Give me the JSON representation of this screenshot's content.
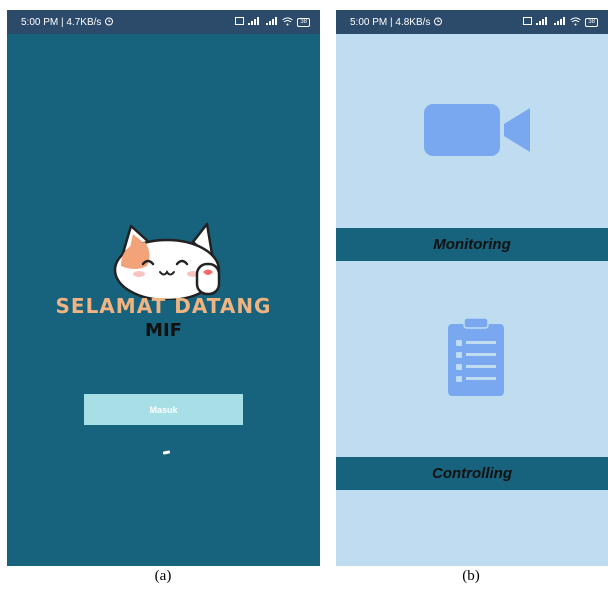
{
  "screen_a": {
    "status": {
      "time_speed": "5:00 PM | 4.7KB/s",
      "battery": "38"
    },
    "welcome_title": "SELAMAT DATANG",
    "welcome_subtitle": "MIF",
    "enter_button_label": "Masuk",
    "caption": "(a)"
  },
  "screen_b": {
    "status": {
      "time_speed": "5:00 PM | 4.8KB/s",
      "battery": "38"
    },
    "menu": [
      {
        "label": "Monitoring",
        "icon": "video-camera-icon"
      },
      {
        "label": "Controlling",
        "icon": "clipboard-checklist-icon"
      }
    ],
    "caption": "(b)"
  },
  "colors": {
    "splash_background": "#17627c",
    "menu_background": "#c0dcf0",
    "button_background": "#a8dfe6",
    "icon_blue": "#7aa8f0",
    "title_color": "#f0b482"
  }
}
